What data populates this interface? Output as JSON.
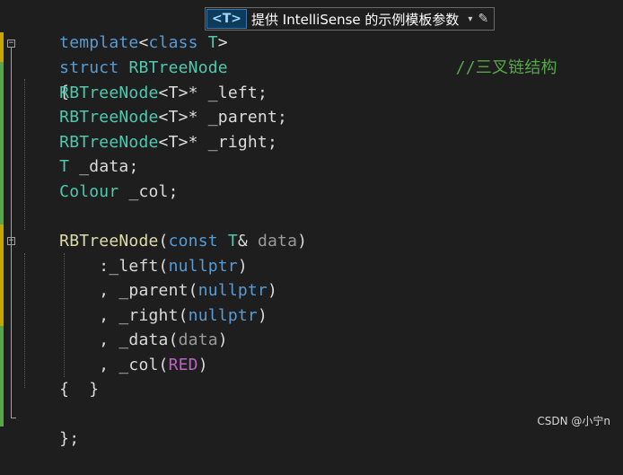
{
  "template_line": {
    "kw_template": "template",
    "open": "<",
    "kw_class": "class",
    "param": "T",
    "close": ">"
  },
  "template_hint": {
    "badge": "<T>",
    "text": "提供 IntelliSense 的示例模板参数",
    "arrow": "▾",
    "edit": "✎"
  },
  "code": {
    "l1": {
      "kw": "struct",
      "name": "RBTreeNode",
      "comment": "//三叉链结构"
    },
    "l2": {
      "brace": "{"
    },
    "l3": {
      "type": "RBTreeNode",
      "targ": "<T>",
      "ptr": "*",
      "field": "_left",
      "semi": ";"
    },
    "l4": {
      "type": "RBTreeNode",
      "targ": "<T>",
      "ptr": "*",
      "field": "_parent",
      "semi": ";"
    },
    "l5": {
      "type": "RBTreeNode",
      "targ": "<T>",
      "ptr": "*",
      "field": "_right",
      "semi": ";"
    },
    "l6": {
      "type": "T",
      "field": "_data",
      "semi": ";"
    },
    "l7": {
      "type": "Colour",
      "field": "_col",
      "semi": ";"
    },
    "l9": {
      "fn": "RBTreeNode",
      "open": "(",
      "kw": "const",
      "type": "T",
      "amp": "&",
      "param": "data",
      "close": ")"
    },
    "l10": {
      "colon": ":",
      "member": "_left",
      "open": "(",
      "val": "nullptr",
      "close": ")"
    },
    "l11": {
      "comma": ",",
      "member": "_parent",
      "open": "(",
      "val": "nullptr",
      "close": ")"
    },
    "l12": {
      "comma": ",",
      "member": "_right",
      "open": "(",
      "val": "nullptr",
      "close": ")"
    },
    "l13": {
      "comma": ",",
      "member": "_data",
      "open": "(",
      "val": "data",
      "close": ")"
    },
    "l14": {
      "comma": ",",
      "member": "_col",
      "open": "(",
      "val": "RED",
      "close": ")"
    },
    "l15": {
      "body": "{  }"
    },
    "l16": {
      "end": "};"
    }
  },
  "watermark": "CSDN @小宁n",
  "colors": {
    "background": "#1e1e1e",
    "keyword": "#569cd6",
    "type": "#4ec9b0",
    "function": "#dcdcaa",
    "comment": "#57a64a",
    "macro": "#bd63c5",
    "change_saved": "#57a64a",
    "change_unsaved": "#c8a600"
  }
}
